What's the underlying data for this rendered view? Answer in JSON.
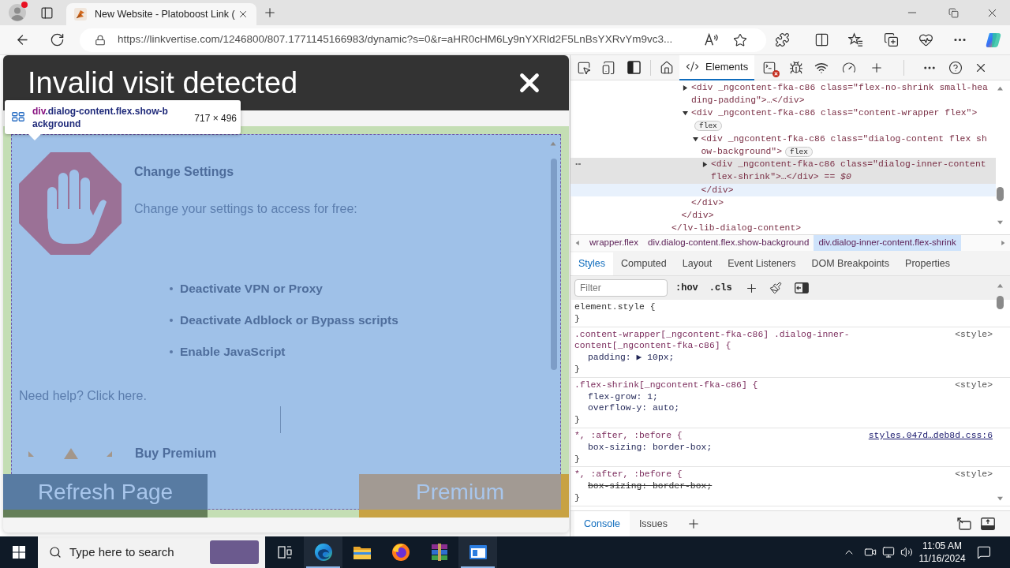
{
  "browser": {
    "tabs": [
      {
        "title": "New Website - Platoboost Link (",
        "selected": true
      }
    ],
    "url": "https://linkvertise.com/1246800/807.1771145166983/dynamic?s=0&r=aHR0cHM6Ly9nYXRld2F5LnBsYXRvYm9vc3..."
  },
  "dialog": {
    "title": "Invalid visit detected",
    "heading": "Change Settings",
    "intro": "Change your settings to access for free:",
    "steps": [
      "Deactivate VPN or Proxy",
      "Deactivate Adblock or Bypass scripts",
      "Enable JavaScript"
    ],
    "help_link": "Need help? Click here.",
    "premium_link": "Buy Premium",
    "buttons": [
      {
        "label": "Refresh Page",
        "kind": "refresh"
      },
      {
        "label": "Premium",
        "kind": "premium"
      }
    ]
  },
  "inspect_tooltip": {
    "tag": "div",
    "class_lines": [
      ".dialog-content.flex.show-b",
      "ackground"
    ],
    "size": "717 × 496"
  },
  "devtools": {
    "tabs": [
      {
        "label": "Elements",
        "selected": true
      }
    ],
    "dom_tree": [
      {
        "close_tag": "</lv-lib-dialog-content>",
        "selected": false,
        "hovered": false,
        "children": [
          {
            "close_tag": "</div>",
            "selected": false,
            "hovered": false,
            "children": [
              {
                "open_lines": [
                  "<div _ngcontent-fka-c86 class=\"flex-no-shrink small-hea",
                  "ding-padding\">…</div>"
                ],
                "expanded": false,
                "selected": false,
                "hovered": false
              },
              {
                "open_lines": [
                  "<div _ngcontent-fka-c86 class=\"content-wrapper flex\">"
                ],
                "badge": "flex",
                "expanded": true,
                "selected": false,
                "hovered": false,
                "close_tag": "</div>",
                "children": [
                  {
                    "open_lines": [
                      "<div _ngcontent-fka-c86 class=\"dialog-content flex sh",
                      "ow-background\">"
                    ],
                    "badge": "flex",
                    "expanded": true,
                    "selected": false,
                    "hovered": true,
                    "close_tag": "</div>",
                    "children": [
                      {
                        "open_lines": [
                          "<div _ngcontent-fka-c86 class=\"dialog-inner-content",
                          "flex-shrink\">…</div> *== $0*"
                        ],
                        "expanded": false,
                        "selected": true,
                        "hovered": false
                      }
                    ]
                  }
                ]
              }
            ]
          }
        ]
      }
    ],
    "breadcrumbs": [
      {
        "label": "wrapper.flex",
        "selected": false
      },
      {
        "label": "div.dialog-content.flex.show-background",
        "selected": false
      },
      {
        "label": "div.dialog-inner-content.flex-shrink",
        "selected": true
      }
    ],
    "pane_tabs": [
      {
        "label": "Styles",
        "selected": true
      },
      {
        "label": "Computed",
        "selected": false
      },
      {
        "label": "Layout",
        "selected": false
      },
      {
        "label": "Event Listeners",
        "selected": false
      },
      {
        "label": "DOM Breakpoints",
        "selected": false
      },
      {
        "label": "Properties",
        "selected": false
      }
    ],
    "filter": {
      "placeholder": "Filter"
    },
    "toggles": [
      ":hov",
      ".cls"
    ],
    "rules": [
      {
        "kind": "inline",
        "selector_lines": [
          "element.style {"
        ],
        "close": "}"
      },
      {
        "kind": "matched",
        "selector_lines": [
          ".content-wrapper[_ngcontent-fka-c86] .dialog-inner-",
          "content[_ngcontent-fka-c86] {"
        ],
        "source": "<style>",
        "source_link": false,
        "declarations": [
          {
            "text": "padding: ▶ 10px;",
            "struck": false
          }
        ],
        "close": "}"
      },
      {
        "kind": "matched",
        "selector_lines": [
          ".flex-shrink[_ngcontent-fka-c86] {"
        ],
        "source": "<style>",
        "source_link": false,
        "declarations": [
          {
            "text": "flex-grow: 1;",
            "struck": false
          },
          {
            "text": "overflow-y: auto;",
            "struck": false
          }
        ],
        "close": "}"
      },
      {
        "kind": "matched",
        "selector_lines": [
          "*, :after, :before {"
        ],
        "source": "styles.047d…deb8d.css:6",
        "source_link": true,
        "declarations": [
          {
            "text": "box-sizing: border-box;",
            "struck": false
          }
        ],
        "close": "}"
      },
      {
        "kind": "matched",
        "selector_lines": [
          "*, :after, :before {"
        ],
        "source": "<style>",
        "source_link": false,
        "declarations": [
          {
            "text": "box-sizing: border-box;",
            "struck": true
          }
        ],
        "close": "}"
      }
    ],
    "drawer_tabs": [
      {
        "label": "Console",
        "selected": true
      },
      {
        "label": "Issues",
        "selected": false
      }
    ]
  },
  "taskbar": {
    "search_placeholder": "Type here to search",
    "apps": [
      {
        "kind": "edge",
        "running": true
      },
      {
        "kind": "explorer",
        "running": false
      },
      {
        "kind": "firefox",
        "running": false
      },
      {
        "kind": "winrar",
        "running": false
      },
      {
        "kind": "window",
        "running": true
      }
    ],
    "time": "11:05 AM",
    "date": "11/16/2024"
  }
}
